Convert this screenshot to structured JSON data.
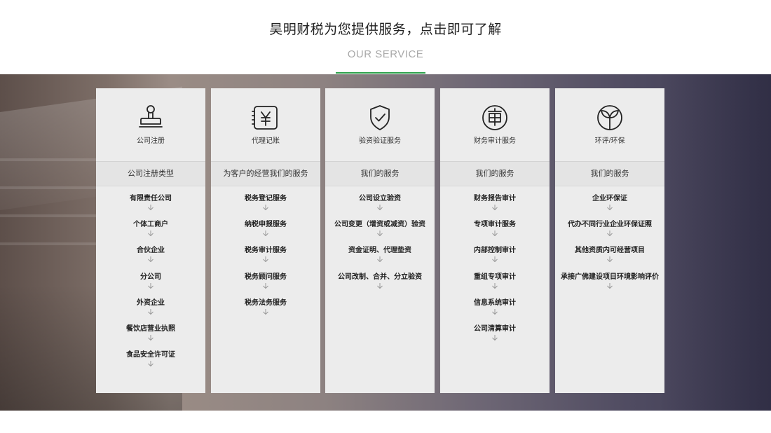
{
  "header": {
    "title": "昊明财税为您提供服务，点击即可了解",
    "subtitle": "OUR  SERVICE"
  },
  "colors": {
    "accent": "#2aa049",
    "card_bg": "#ececec"
  },
  "cards": [
    {
      "icon": "stamp-icon",
      "name": "公司注册",
      "heading": "公司注册类型",
      "items": [
        "有限责任公司",
        "个体工商户",
        "合伙企业",
        "分公司",
        "外资企业",
        "餐饮店营业执照",
        "食品安全许可证"
      ]
    },
    {
      "icon": "ledger-yuan-icon",
      "name": "代理记账",
      "heading": "为客户的经营我们的服务",
      "items": [
        "税务登记服务",
        "纳税申报服务",
        "税务审计服务",
        "税务顾问服务",
        "税务法务服务"
      ]
    },
    {
      "icon": "shield-check-icon",
      "name": "验资验证服务",
      "heading": "我们的服务",
      "items": [
        "公司设立验资",
        "公司变更（增资或减资）验资",
        "资金证明、代理垫资",
        "公司改制、合并、分立验资"
      ]
    },
    {
      "icon": "audit-seal-icon",
      "name": "财务审计服务",
      "heading": "我们的服务",
      "items": [
        "财务报告审计",
        "专项审计服务",
        "内部控制审计",
        "重组专项审计",
        "信息系统审计",
        "公司清算审计"
      ]
    },
    {
      "icon": "sprout-icon",
      "name": "环评/环保",
      "heading": "我们的服务",
      "items": [
        "企业环保证",
        "代办不同行业企业环保证照",
        "其他资质内可经营项目",
        "承接广佛建设项目环境影响评价"
      ]
    }
  ]
}
